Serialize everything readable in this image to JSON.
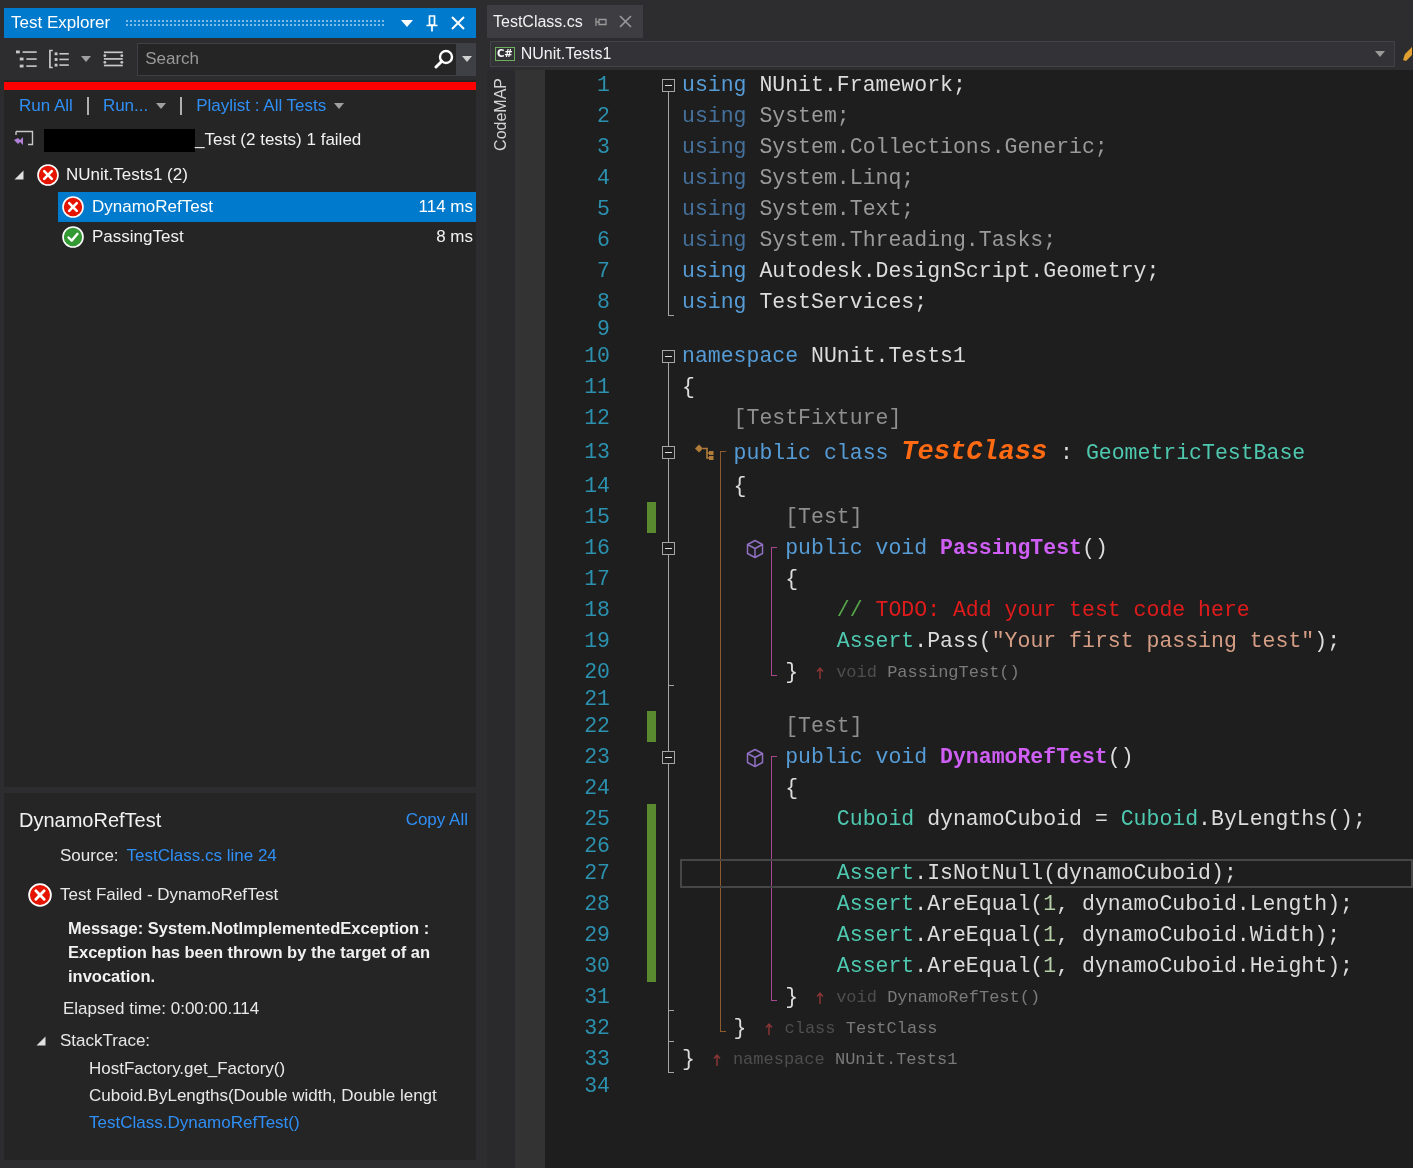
{
  "explorer": {
    "title": "Test Explorer",
    "search": {
      "placeholder": "Search"
    },
    "progress": {
      "level": 1,
      "passed": false
    },
    "links": [
      {
        "label": "Run All",
        "menu": false
      },
      {
        "label": "Run...",
        "menu": true
      },
      {
        "label": "Playlist : All Tests",
        "menu": true
      }
    ],
    "project": {
      "label": "_Test (2 tests) 1 failed",
      "redacted": true
    },
    "tree": [
      {
        "label": "NUnit.Tests1 (2)",
        "passed": false,
        "expanded": true,
        "selected": false,
        "children": [
          {
            "label": "DynamoRefTest",
            "passed": false,
            "duration": "114 ms",
            "selected": true
          },
          {
            "label": "PassingTest",
            "passed": true,
            "duration": "8 ms",
            "selected": false
          }
        ]
      }
    ],
    "details": {
      "title": "DynamoRefTest",
      "copy": "Copy All",
      "source_label": "Source:",
      "source_link": "TestClass.cs line 24",
      "passed": false,
      "result": "Test Failed - DynamoRefTest",
      "message": "Message: System.NotImplementedException : Exception has been thrown by the target of an invocation.",
      "elapsed": "Elapsed time: 0:00:00.114",
      "stack_label": "StackTrace:",
      "stack_expanded": true,
      "stack": [
        {
          "text": "HostFactory.get_Factory()",
          "link": false
        },
        {
          "text": "Cuboid.ByLengths(Double width, Double lengt",
          "link": false
        },
        {
          "text": "TestClass.DynamoRefTest()",
          "link": true
        }
      ]
    }
  },
  "editor": {
    "tabs": [
      {
        "label": "TestClass.cs",
        "selected": true
      }
    ],
    "navigation": {
      "language": "C#",
      "scope": "NUnit.Tests1"
    },
    "codemap": "CodeMAP",
    "lines": [
      {
        "number": "1",
        "fold": {
          "kind": "start",
          "expanded": true
        },
        "changed": false,
        "current": false,
        "tokens": [
          {
            "kind": "keyword",
            "text": "using"
          },
          {
            "kind": "plain",
            "text": " NUnit.Framework;"
          }
        ]
      },
      {
        "number": "2",
        "fold": {
          "kind": "inside"
        },
        "changed": false,
        "current": false,
        "tokens": [
          {
            "kind": "keyword_faded",
            "text": "using"
          },
          {
            "kind": "faded",
            "text": " System;"
          }
        ]
      },
      {
        "number": "3",
        "fold": {
          "kind": "inside"
        },
        "changed": false,
        "current": false,
        "tokens": [
          {
            "kind": "keyword_faded",
            "text": "using"
          },
          {
            "kind": "faded",
            "text": " System.Collections.Generic;"
          }
        ]
      },
      {
        "number": "4",
        "fold": {
          "kind": "inside"
        },
        "changed": false,
        "current": false,
        "tokens": [
          {
            "kind": "keyword_faded",
            "text": "using"
          },
          {
            "kind": "faded",
            "text": " System.Linq;"
          }
        ]
      },
      {
        "number": "5",
        "fold": {
          "kind": "inside"
        },
        "changed": false,
        "current": false,
        "tokens": [
          {
            "kind": "keyword_faded",
            "text": "using"
          },
          {
            "kind": "faded",
            "text": " System.Text;"
          }
        ]
      },
      {
        "number": "6",
        "fold": {
          "kind": "inside"
        },
        "changed": false,
        "current": false,
        "tokens": [
          {
            "kind": "keyword_faded",
            "text": "using"
          },
          {
            "kind": "faded",
            "text": " System.Threading.Tasks;"
          }
        ]
      },
      {
        "number": "7",
        "fold": {
          "kind": "inside"
        },
        "changed": false,
        "current": false,
        "tokens": [
          {
            "kind": "keyword",
            "text": "using"
          },
          {
            "kind": "plain",
            "text": " Autodesk.DesignScript.Geometry;"
          }
        ]
      },
      {
        "number": "8",
        "fold": {
          "kind": "end"
        },
        "changed": false,
        "current": false,
        "tokens": [
          {
            "kind": "keyword",
            "text": "using"
          },
          {
            "kind": "plain",
            "text": " TestServices;"
          }
        ]
      },
      {
        "number": "9",
        "changed": false,
        "current": false
      },
      {
        "number": "10",
        "fold": {
          "kind": "start",
          "expanded": true
        },
        "changed": false,
        "current": false,
        "tokens": [
          {
            "kind": "keyword",
            "text": "namespace"
          },
          {
            "kind": "plain",
            "text": " NUnit.Tests1"
          }
        ]
      },
      {
        "number": "11",
        "fold": {
          "kind": "inside"
        },
        "changed": false,
        "current": false,
        "tokens": [
          {
            "kind": "plain",
            "text": "{"
          }
        ]
      },
      {
        "number": "12",
        "fold": {
          "kind": "inside"
        },
        "changed": false,
        "current": false,
        "tokens": [
          {
            "kind": "attribute",
            "text": "    [TestFixture]"
          }
        ]
      },
      {
        "number": "13",
        "fold": {
          "kind": "start",
          "expanded": true
        },
        "member": {
          "kind": "class"
        },
        "changed": false,
        "current": false,
        "tokens": [
          {
            "kind": "keyword",
            "text": "    public class "
          },
          {
            "kind": "class_name",
            "text": "TestClass"
          },
          {
            "kind": "plain",
            "text": " : "
          },
          {
            "kind": "type",
            "text": "GeometricTestBase"
          }
        ]
      },
      {
        "number": "14",
        "fold": {
          "kind": "inside"
        },
        "changed": false,
        "current": false,
        "tokens": [
          {
            "kind": "plain",
            "text": "    {"
          }
        ]
      },
      {
        "number": "15",
        "fold": {
          "kind": "inside"
        },
        "changed": true,
        "current": false,
        "tokens": [
          {
            "kind": "attribute",
            "text": "        [Test]"
          }
        ]
      },
      {
        "number": "16",
        "fold": {
          "kind": "start",
          "expanded": true
        },
        "member": {
          "kind": "method"
        },
        "changed": false,
        "current": false,
        "tokens": [
          {
            "kind": "keyword",
            "text": "        public void "
          },
          {
            "kind": "method_name",
            "text": "PassingTest"
          },
          {
            "kind": "plain",
            "text": "()"
          }
        ]
      },
      {
        "number": "17",
        "fold": {
          "kind": "inside"
        },
        "changed": false,
        "current": false,
        "tokens": [
          {
            "kind": "plain",
            "text": "        {"
          }
        ]
      },
      {
        "number": "18",
        "fold": {
          "kind": "inside"
        },
        "changed": false,
        "current": false,
        "tokens": [
          {
            "kind": "comment",
            "text": "            // "
          },
          {
            "kind": "todo",
            "text": "TODO: Add your test code here"
          }
        ]
      },
      {
        "number": "19",
        "fold": {
          "kind": "inside"
        },
        "changed": false,
        "current": false,
        "tokens": [
          {
            "kind": "type",
            "text": "            Assert"
          },
          {
            "kind": "plain",
            "text": ".Pass("
          },
          {
            "kind": "string",
            "text": "\"Your first passing test\""
          },
          {
            "kind": "plain",
            "text": ");"
          }
        ]
      },
      {
        "number": "20",
        "fold": {
          "kind": "end"
        },
        "changed": false,
        "current": false,
        "tokens": [
          {
            "kind": "plain",
            "text": "        }"
          }
        ],
        "end_hint": {
          "kind": "method",
          "keyword": "void",
          "name": "PassingTest()"
        }
      },
      {
        "number": "21",
        "fold": {
          "kind": "inside"
        },
        "changed": false,
        "current": false
      },
      {
        "number": "22",
        "fold": {
          "kind": "inside"
        },
        "changed": true,
        "current": false,
        "tokens": [
          {
            "kind": "attribute",
            "text": "        [Test]"
          }
        ]
      },
      {
        "number": "23",
        "fold": {
          "kind": "start",
          "expanded": true
        },
        "member": {
          "kind": "method"
        },
        "changed": false,
        "current": false,
        "tokens": [
          {
            "kind": "keyword",
            "text": "        public void "
          },
          {
            "kind": "method_name",
            "text": "DynamoRefTest"
          },
          {
            "kind": "plain",
            "text": "()"
          }
        ]
      },
      {
        "number": "24",
        "fold": {
          "kind": "inside"
        },
        "changed": false,
        "current": false,
        "tokens": [
          {
            "kind": "plain",
            "text": "        {"
          }
        ]
      },
      {
        "number": "25",
        "fold": {
          "kind": "inside"
        },
        "changed": true,
        "current": false,
        "tokens": [
          {
            "kind": "type",
            "text": "            Cuboid"
          },
          {
            "kind": "plain",
            "text": " dynamoCuboid = "
          },
          {
            "kind": "type",
            "text": "Cuboid"
          },
          {
            "kind": "plain",
            "text": ".ByLengths();"
          }
        ]
      },
      {
        "number": "26",
        "fold": {
          "kind": "inside"
        },
        "changed": true,
        "current": false
      },
      {
        "number": "27",
        "fold": {
          "kind": "inside"
        },
        "changed": true,
        "current": true,
        "tokens": [
          {
            "kind": "type",
            "text": "            Assert"
          },
          {
            "kind": "plain",
            "text": ".IsNotNull(dynamoCuboid);"
          }
        ]
      },
      {
        "number": "28",
        "fold": {
          "kind": "inside"
        },
        "changed": true,
        "current": false,
        "tokens": [
          {
            "kind": "type",
            "text": "            Assert"
          },
          {
            "kind": "plain",
            "text": ".AreEqual("
          },
          {
            "kind": "number",
            "text": "1"
          },
          {
            "kind": "plain",
            "text": ", dynamoCuboid.Length);"
          }
        ]
      },
      {
        "number": "29",
        "fold": {
          "kind": "inside"
        },
        "changed": true,
        "current": false,
        "tokens": [
          {
            "kind": "type",
            "text": "            Assert"
          },
          {
            "kind": "plain",
            "text": ".AreEqual("
          },
          {
            "kind": "number",
            "text": "1"
          },
          {
            "kind": "plain",
            "text": ", dynamoCuboid.Width);"
          }
        ]
      },
      {
        "number": "30",
        "fold": {
          "kind": "inside"
        },
        "changed": true,
        "current": false,
        "tokens": [
          {
            "kind": "type",
            "text": "            Assert"
          },
          {
            "kind": "plain",
            "text": ".AreEqual("
          },
          {
            "kind": "number",
            "text": "1"
          },
          {
            "kind": "plain",
            "text": ", dynamoCuboid.Height);"
          }
        ]
      },
      {
        "number": "31",
        "fold": {
          "kind": "end"
        },
        "changed": false,
        "current": false,
        "tokens": [
          {
            "kind": "plain",
            "text": "        }"
          }
        ],
        "end_hint": {
          "kind": "method",
          "keyword": "void",
          "name": "DynamoRefTest()"
        }
      },
      {
        "number": "32",
        "fold": {
          "kind": "end"
        },
        "changed": false,
        "current": false,
        "tokens": [
          {
            "kind": "plain",
            "text": "    }"
          }
        ],
        "end_hint": {
          "kind": "class",
          "keyword": "class",
          "name": "TestClass"
        }
      },
      {
        "number": "33",
        "fold": {
          "kind": "end"
        },
        "changed": false,
        "current": false,
        "tokens": [
          {
            "kind": "plain",
            "text": "}"
          }
        ],
        "end_hint": {
          "kind": "namespace",
          "keyword": "namespace",
          "name": "NUnit.Tests1"
        }
      },
      {
        "number": "34",
        "changed": false,
        "current": false
      }
    ]
  }
}
